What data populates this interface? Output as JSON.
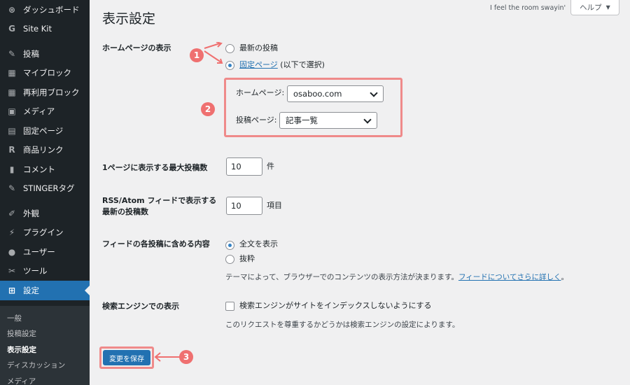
{
  "sidebar": {
    "items": [
      {
        "icon": "dashboard-icon",
        "glyph": "⊛",
        "label": "ダッシュボード"
      },
      {
        "icon": "sitekit-icon",
        "glyph": "G",
        "label": "Site Kit"
      },
      {
        "icon": "pin-icon",
        "glyph": "✎",
        "label": "投稿"
      },
      {
        "icon": "blocks-icon",
        "glyph": "▦",
        "label": "マイブロック"
      },
      {
        "icon": "blocks-icon",
        "glyph": "▦",
        "label": "再利用ブロック"
      },
      {
        "icon": "media-icon",
        "glyph": "▣",
        "label": "メディア"
      },
      {
        "icon": "page-icon",
        "glyph": "▤",
        "label": "固定ページ"
      },
      {
        "icon": "product-icon",
        "glyph": "R",
        "label": "商品リンク"
      },
      {
        "icon": "comment-icon",
        "glyph": "▮",
        "label": "コメント"
      },
      {
        "icon": "pin-icon",
        "glyph": "✎",
        "label": "STINGERタグ"
      },
      {
        "icon": "appearance-icon",
        "glyph": "✐",
        "label": "外観"
      },
      {
        "icon": "plugin-icon",
        "glyph": "⚡",
        "label": "プラグイン"
      },
      {
        "icon": "user-icon",
        "glyph": "●",
        "label": "ユーザー"
      },
      {
        "icon": "tools-icon",
        "glyph": "✂",
        "label": "ツール"
      },
      {
        "icon": "settings-icon",
        "glyph": "⊞",
        "label": "設定"
      }
    ],
    "submenu": [
      "一般",
      "投稿設定",
      "表示設定",
      "ディスカッション",
      "メディア"
    ]
  },
  "header": {
    "lyric": "I feel the room swayin'",
    "help_label": "ヘルプ",
    "help_arrow": "▼"
  },
  "page_title": "表示設定",
  "homepage_display": {
    "label": "ホームページの表示",
    "option_latest": "最新の投稿",
    "option_static_link": "固定ページ",
    "option_static_suffix": " (以下で選択)",
    "homepage_label": "ホームページ:",
    "homepage_value": "osaboo.com",
    "posts_page_label": "投稿ページ:",
    "posts_page_value": "記事一覧"
  },
  "posts_per_page": {
    "label": "1ページに表示する最大投稿数",
    "value": "10",
    "unit": "件"
  },
  "feed_count": {
    "label": "RSS/Atom フィードで表示する最新の投稿数",
    "value": "10",
    "unit": "項目"
  },
  "feed_content": {
    "label": "フィードの各投稿に含める内容",
    "option_full": "全文を表示",
    "option_excerpt": "抜粋",
    "desc_text": "テーマによって、ブラウザーでのコンテンツの表示方法が決まります。",
    "desc_link": "フィードについてさらに詳しく",
    "desc_end": "。"
  },
  "search_engine": {
    "label": "検索エンジンでの表示",
    "checkbox_label": "検索エンジンがサイトをインデックスしないようにする",
    "desc": "このリクエストを尊重するかどうかは検索エンジンの設定によります。"
  },
  "save_label": "変更を保存",
  "annotations": {
    "badge1": "1",
    "badge2": "2",
    "badge3": "3",
    "color": "#ef7070"
  },
  "colors": {
    "sidebar_bg": "#1d2327",
    "accent": "#2271b1",
    "page_bg": "#f0f0f1"
  }
}
